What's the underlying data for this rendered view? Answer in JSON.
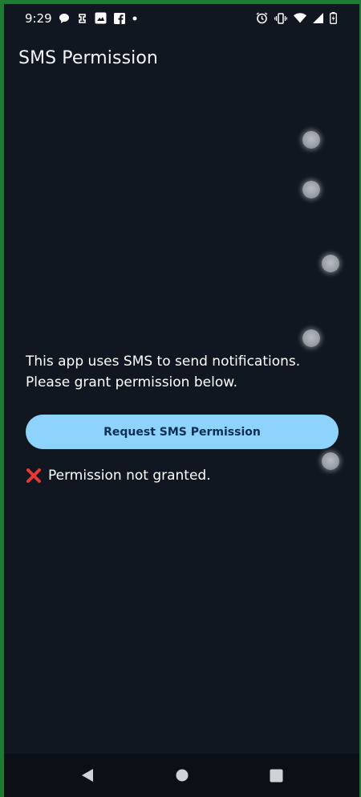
{
  "status_bar": {
    "time": "9:29",
    "left_icons": [
      "chat-icon",
      "puzzle-icon",
      "photo-icon",
      "facebook-icon",
      "more-dot-icon"
    ],
    "right_icons": [
      "alarm-icon",
      "vibrate-icon",
      "wifi-icon",
      "signal-icon",
      "battery-icon"
    ]
  },
  "app_bar": {
    "title": "SMS Permission"
  },
  "main": {
    "explanation_line1": "This app uses SMS to send notifications.",
    "explanation_line2": "Please grant permission below.",
    "request_button_label": "Request SMS Permission",
    "permission_status": "Permission not granted."
  },
  "colors": {
    "background": "#111721",
    "button": "#8ed3fb",
    "button_text": "#0f2f52",
    "error_icon": "#e53935",
    "frame": "#1f7a34"
  },
  "nav_bar": {
    "buttons": [
      "back-icon",
      "home-icon",
      "recents-icon"
    ]
  }
}
